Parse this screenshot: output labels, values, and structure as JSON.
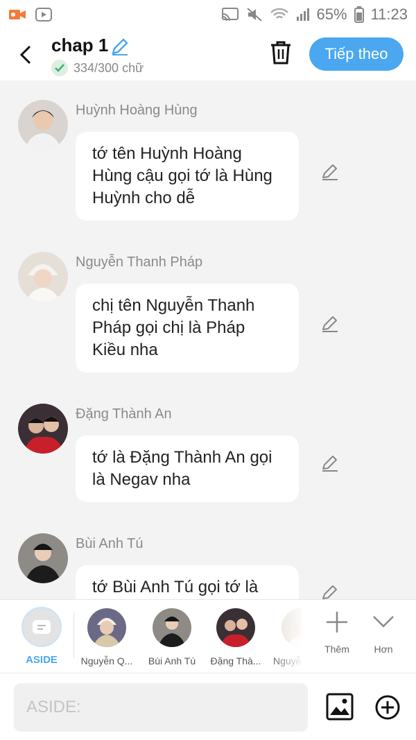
{
  "status_bar": {
    "battery": "65%",
    "time": "11:23"
  },
  "header": {
    "title": "chap 1",
    "word_count": "334/300 chữ",
    "next_label": "Tiếp theo"
  },
  "messages": [
    {
      "sender": "Huỳnh Hoàng Hùng",
      "text": "tớ tên Huỳnh Hoàng Hùng cậu gọi tớ là Hùng Huỳnh cho dễ"
    },
    {
      "sender": "Nguyễn Thanh Pháp",
      "text": "chị tên Nguyễn Thanh Pháp gọi chị là Pháp Kiều nha"
    },
    {
      "sender": "Đặng Thành An",
      "text": "tớ là Đặng Thành An gọi là Negav nha"
    },
    {
      "sender": "Bùi Anh Tú",
      "text": "tớ Bùi Anh Tú gọi tớ là"
    }
  ],
  "characters": {
    "aside_label": "ASIDE",
    "items": [
      {
        "name": "Nguyễn Q..."
      },
      {
        "name": "Bùi Anh Tú"
      },
      {
        "name": "Đặng Thà..."
      },
      {
        "name": "Nguyễ"
      }
    ],
    "add_label": "Thêm",
    "more_label": "Hơn"
  },
  "composer": {
    "placeholder": "ASIDE:"
  },
  "colors": {
    "accent": "#4aa7f0",
    "background": "#f3f3f3",
    "check_green": "#3cb371"
  }
}
